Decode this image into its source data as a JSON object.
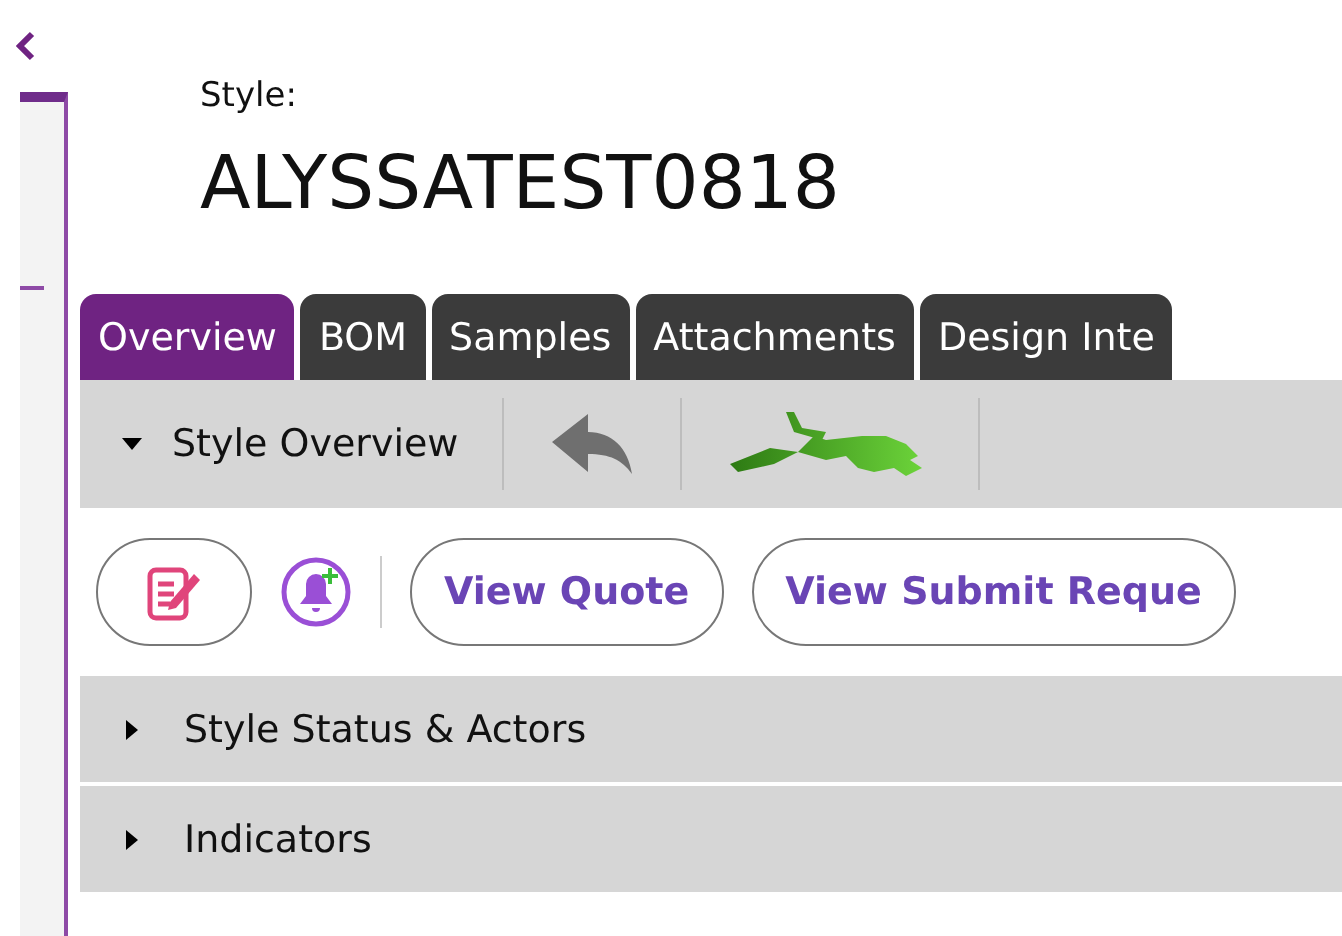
{
  "header": {
    "label": "Style:",
    "title": "ALYSSATEST0818"
  },
  "tabs": [
    {
      "label": "Overview",
      "selected": true
    },
    {
      "label": "BOM",
      "selected": false
    },
    {
      "label": "Samples",
      "selected": false
    },
    {
      "label": "Attachments",
      "selected": false
    },
    {
      "label": "Design Inte",
      "selected": false
    }
  ],
  "toolbar": {
    "section": "Style Overview",
    "expanded": true
  },
  "actions": [
    {
      "label": "View Quote"
    },
    {
      "label": "View Submit Reque"
    }
  ],
  "sections": [
    {
      "label": "Style Status & Actors",
      "expanded": false
    },
    {
      "label": "Indicators",
      "expanded": false
    }
  ]
}
